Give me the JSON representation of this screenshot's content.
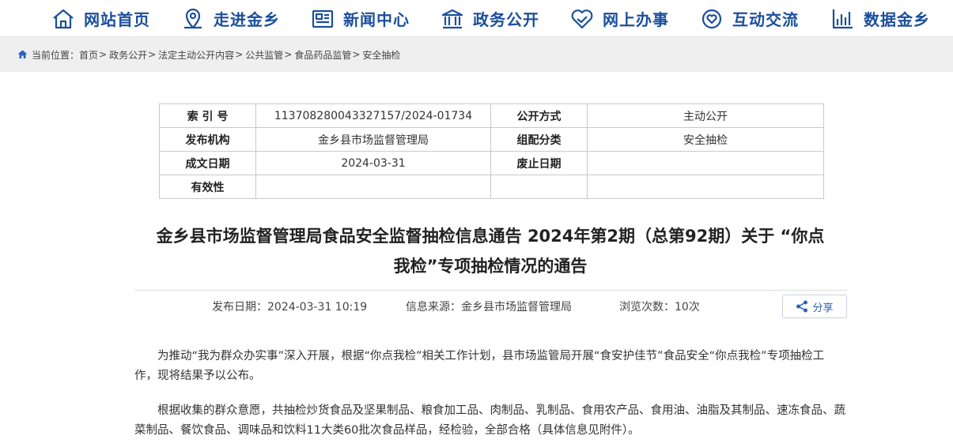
{
  "nav": {
    "items": [
      {
        "label": "网站首页",
        "icon": "home-icon"
      },
      {
        "label": "走进金乡",
        "icon": "map-pin-icon"
      },
      {
        "label": "新闻中心",
        "icon": "newspaper-icon"
      },
      {
        "label": "政务公开",
        "icon": "government-building-icon"
      },
      {
        "label": "网上办事",
        "icon": "handshake-heart-icon"
      },
      {
        "label": "互动交流",
        "icon": "hand-heart-icon"
      },
      {
        "label": "数据金乡",
        "icon": "bar-chart-icon"
      }
    ],
    "color": "#1b4f9c"
  },
  "breadcrumb": {
    "prefix": "当前位置：",
    "items": [
      "首页",
      "政务公开",
      "法定主动公开内容",
      "公共监管",
      "食品药品监管",
      "安全抽检"
    ],
    "separator": ">"
  },
  "meta": {
    "index_label": "索 引 号",
    "index_value": "113708280043327157/2024-01734",
    "open_mode_label": "公开方式",
    "open_mode_value": "主动公开",
    "publisher_label": "发布机构",
    "publisher_value": "金乡县市场监督管理局",
    "category_label": "组配分类",
    "category_value": "安全抽检",
    "created_label": "成文日期",
    "created_value": "2024-03-31",
    "abolish_label": "废止日期",
    "abolish_value": "",
    "validity_label": "有效性",
    "validity_value": ""
  },
  "article": {
    "title_line1": "金乡县市场监督管理局食品安全监督抽检信息通告 2024年第2期（总第92期）关于 “你点",
    "title_line2": "我检”专项抽检情况的通告",
    "publish_date": "发布日期：2024-03-31 10:19",
    "source": "信息来源：金乡县市场监督管理局",
    "views": "浏览次数：10次",
    "share_label": "分享",
    "paragraph1": "为推动“我为群众办实事”深入开展，根据“你点我检”相关工作计划，县市场监管局开展“食安护佳节”食品安全“你点我检”专项抽检工作，现将结果予以公布。",
    "paragraph2": "根据收集的群众意愿，共抽检炒货食品及坚果制品、粮食加工品、肉制品、乳制品、食用农产品、食用油、油脂及其制品、速冻食品、蔬菜制品、餐饮食品、调味品和饮料11大类60批次食品样品，经检验，全部合格（具体信息见附件）。"
  }
}
